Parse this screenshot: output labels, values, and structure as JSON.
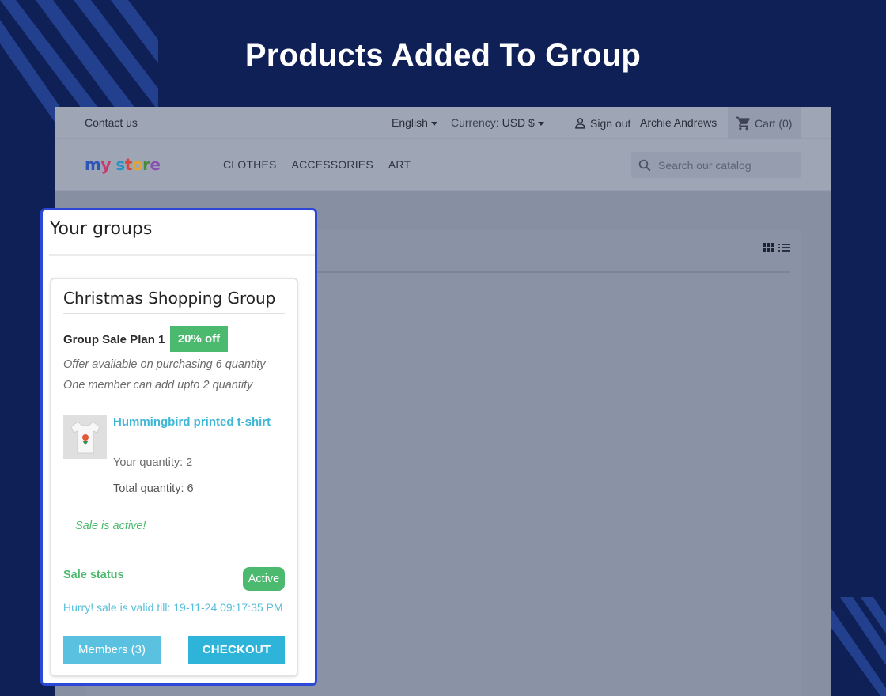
{
  "page": {
    "title": "Products Added To Group"
  },
  "store": {
    "topbar": {
      "contact": "Contact us",
      "language": "English",
      "currency_label": "Currency:",
      "currency_value": "USD $",
      "sign_out": "Sign out",
      "user_name": "Archie Andrews",
      "cart": "Cart (0)"
    },
    "logo": {
      "text": "my store",
      "icon": "my-store-logo"
    },
    "menu": [
      "CLOTHES",
      "ACCESSORIES",
      "ART"
    ],
    "search": {
      "placeholder": "Search our catalog",
      "icon": "search-icon"
    }
  },
  "groups": {
    "title": "Your groups",
    "card": {
      "name": "Christmas Shopping Group",
      "plan": "Group Sale Plan 1",
      "discount": "20% off",
      "offer_line1": "Offer available on purchasing 6 quantity",
      "offer_line2": "One member can add upto 2 quantity",
      "product": {
        "name": "Hummingbird printed t-shirt",
        "your_quantity": "Your quantity: 2",
        "total_quantity": "Total quantity: 6",
        "image_icon": "tshirt-icon"
      },
      "sale_message": "Sale is active!",
      "sale_status_label": "Sale status",
      "sale_status": "Active",
      "valid_till": "Hurry! sale is valid till:  19-11-24 09:17:35 PM",
      "members_button": "Members (3)",
      "checkout_button": "CHECKOUT"
    }
  },
  "colors": {
    "background": "#0f2057",
    "panel_border": "#2b49d6",
    "success": "#4cba6e",
    "accent": "#2fb4d9",
    "link": "#3eb6d6"
  }
}
